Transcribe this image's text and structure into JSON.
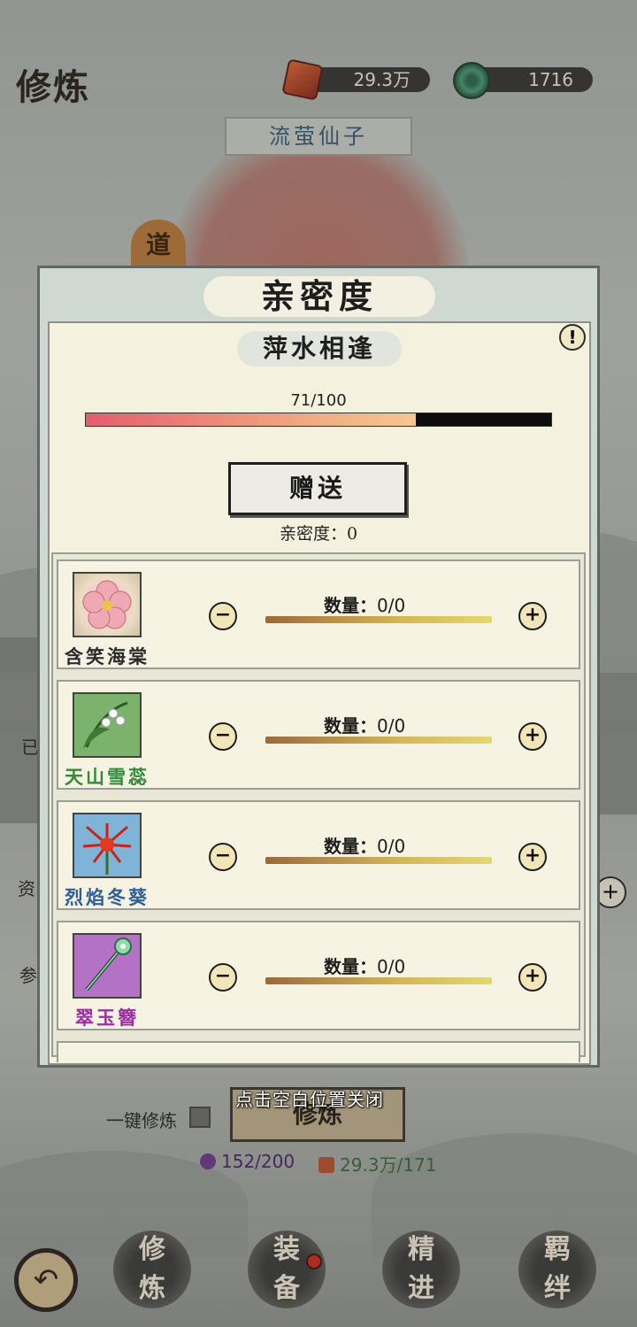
{
  "header": {
    "title": "修炼",
    "currency1": "29.3万",
    "currency2": "1716"
  },
  "character_name": "流萤仙子",
  "dao_tag": "道",
  "side_labels": {
    "left1": "已",
    "left2": "资",
    "left3": "参"
  },
  "modal": {
    "title": "亲密度",
    "stage": "萍水相逢",
    "info_icon": "!",
    "progress_text": "71/100",
    "progress_fraction": 0.71,
    "gift_label": "赠送",
    "gift_intimacy": "亲密度：0",
    "close_hint": "点击空白位置关闭",
    "items": [
      {
        "name": "含笑海棠",
        "color": "#2b2b2b",
        "qty_label": "数量：",
        "qty": "0/0",
        "icon": "begonia-flower-icon",
        "minus": "−",
        "plus": "+"
      },
      {
        "name": "天山雪蕊",
        "color": "#2f8a3a",
        "qty_label": "数量：",
        "qty": "0/0",
        "icon": "lily-of-valley-icon",
        "minus": "−",
        "plus": "+"
      },
      {
        "name": "烈焰冬葵",
        "color": "#2f5f9a",
        "qty_label": "数量：",
        "qty": "0/0",
        "icon": "red-spider-lily-icon",
        "minus": "−",
        "plus": "+"
      },
      {
        "name": "翠玉簪",
        "color": "#9a2fa0",
        "qty_label": "数量：",
        "qty": "0/0",
        "icon": "jade-hairpin-icon",
        "minus": "−",
        "plus": "+"
      }
    ]
  },
  "cultivate": {
    "one_key_label": "一键修炼",
    "button_label": "修炼",
    "cost1": "152/200",
    "cost2": "29.3万/171"
  },
  "nav": {
    "back_icon": "↶",
    "items": [
      {
        "top": "修",
        "bottom": "炼"
      },
      {
        "top": "装",
        "bottom": "备"
      },
      {
        "top": "精",
        "bottom": "进"
      },
      {
        "top": "羁",
        "bottom": "绊"
      }
    ]
  }
}
